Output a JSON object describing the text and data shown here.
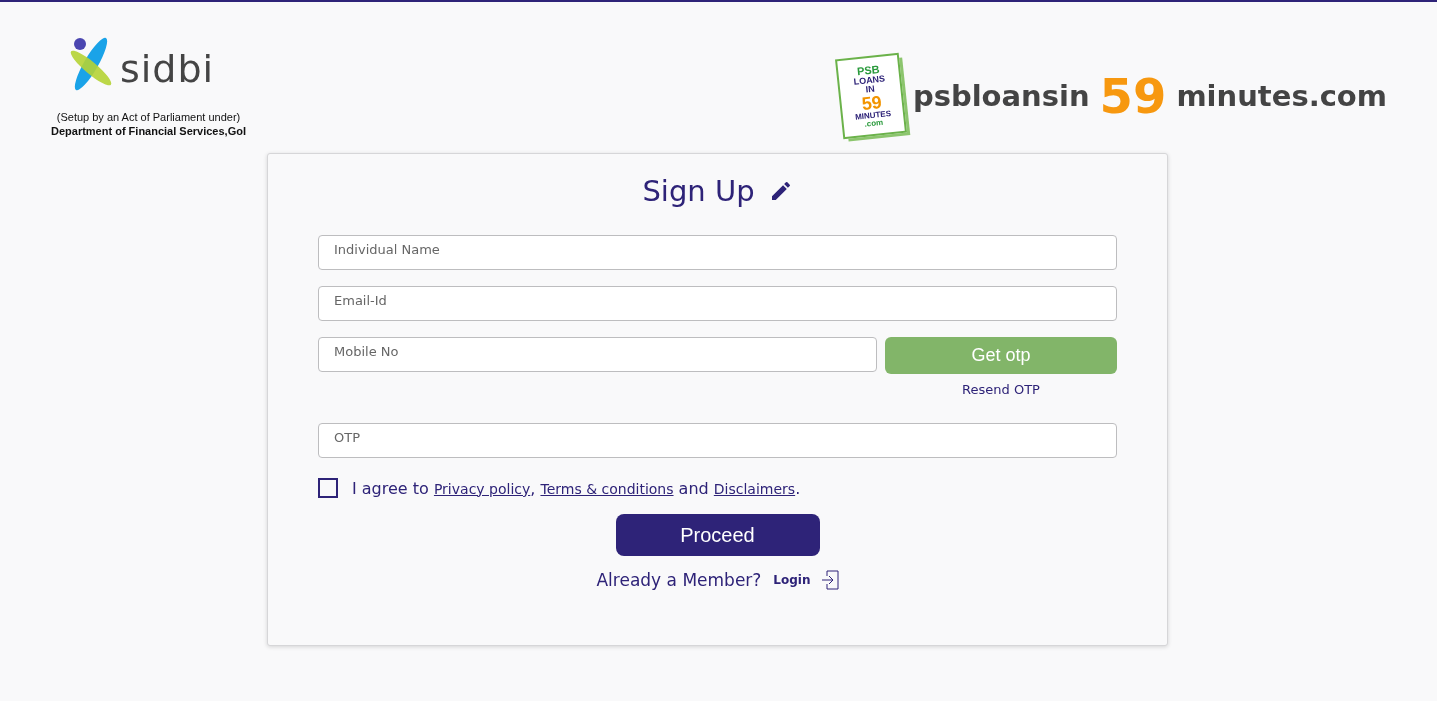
{
  "header": {
    "sidbi_logo": {
      "text": "sidbi",
      "caption_1": "(Setup by an Act of Parliament under)",
      "caption_2": "Department of Financial Services,GoI"
    },
    "psb_logo": {
      "badge": [
        "PSB",
        "LOANS",
        "IN",
        "59",
        "MINUTES",
        ".com"
      ],
      "text_1": "psbloansin",
      "text_2": "59",
      "text_3": "minutes.com"
    }
  },
  "form": {
    "title": "Sign Up",
    "fields": [
      {
        "placeholder": "Individual Name"
      },
      {
        "placeholder": "Email-Id"
      },
      {
        "placeholder": "Mobile No",
        "button": "Get otp",
        "link": "Resend OTP"
      },
      {
        "placeholder": "OTP"
      }
    ],
    "agreement": {
      "checked": false,
      "parts": [
        {
          "kind": "text",
          "text": "I agree to "
        },
        {
          "kind": "link",
          "text": "Privacy policy"
        },
        {
          "kind": "text",
          "text": ", "
        },
        {
          "kind": "link",
          "text": "Terms & conditions"
        },
        {
          "kind": "text",
          "text": " and "
        },
        {
          "kind": "link",
          "text": "Disclaimers"
        },
        {
          "kind": "text",
          "text": "."
        }
      ]
    },
    "submit": "Proceed",
    "member_text": "Already a Member?",
    "login": "Login"
  }
}
